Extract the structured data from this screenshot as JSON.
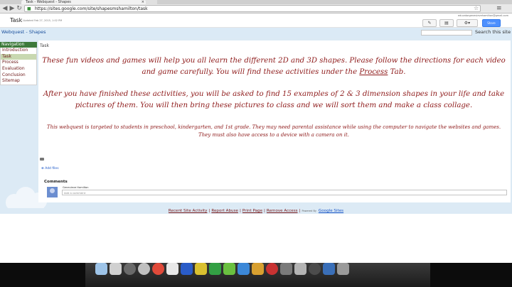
{
  "browser": {
    "tab_title": "Task - Webquest - Shapes",
    "url": "https://sites.google.com/site/shapesmshamilton/task",
    "back_icon": "arrow-left-icon",
    "forward_icon": "arrow-right-icon",
    "reload_icon": "reload-icon",
    "lock_icon": "lock-icon",
    "star_icon": "star-icon",
    "menu_icon": "menu-icon"
  },
  "header": {
    "page_name": "Task",
    "updated": "Updated Feb 27, 2015, 1:02 PM",
    "user_email": "educatorgenevievehamilton@gmail.com",
    "share_label": "Share"
  },
  "banner": {
    "site_title": "Webquest - Shapes",
    "search_label": "Search this site"
  },
  "sidebar": {
    "heading": "Navigation",
    "items": [
      {
        "label": "Introduction"
      },
      {
        "label": "Task"
      },
      {
        "label": "Process"
      },
      {
        "label": "Evaluation"
      },
      {
        "label": "Conclusion"
      },
      {
        "label": "Sitemap"
      }
    ]
  },
  "main": {
    "crumb": "Task",
    "p1_before": "These fun videos and games will help you all learn the different 2D and 3D shapes. Please follow the directions for each video and game carefully. You will find these activities under the ",
    "p1_link": "Process",
    "p1_after": " Tab.",
    "p2": "After you have finished these activities, you will be asked to find 15 examples of 2 & 3 dimension shapes in your life and take pictures of them. You will then bring these pictures to class and we will sort them and make a class collage.",
    "p3": "This webquest is targeted to students in preschool, kindergarten, and 1st grade. They may need parental assistance while using the computer to navigate the websites and games. They must also have access to a device with a camera on it."
  },
  "attachments": {
    "add_files": "Add files"
  },
  "comments": {
    "title": "Comments",
    "commenter": "Genevieve Hamilton",
    "placeholder": "Add a comment"
  },
  "footer": {
    "links": [
      "Recent Site Activity",
      "Report Abuse",
      "Print Page",
      "Remove Access"
    ],
    "powered_by": "Powered By",
    "google_sites": "Google Sites"
  },
  "colors": {
    "accent_red": "#8e1a1a",
    "nav_green": "#3d7a3b",
    "banner_blue": "#dbeaf6"
  }
}
